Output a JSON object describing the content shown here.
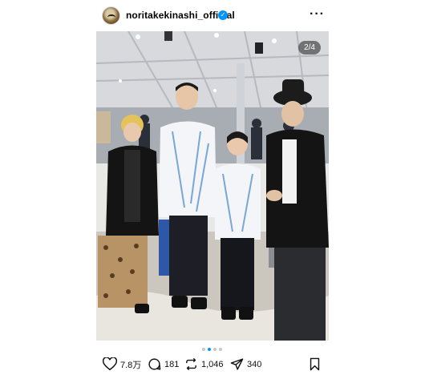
{
  "header": {
    "username": "noritakekinashi_official",
    "verified_icon": "verified-badge-icon",
    "more_icon": "more-options-icon"
  },
  "photo": {
    "counter": "2/4",
    "carousel": {
      "count": 4,
      "active_index": 1
    }
  },
  "actions": {
    "likes": "7.8万",
    "comments": "181",
    "reposts": "1,046",
    "shares": "340",
    "icons": [
      "heart-icon",
      "comment-icon",
      "repost-icon",
      "share-icon",
      "bookmark-icon"
    ]
  },
  "colors": {
    "accent": "#0095f6",
    "text": "#000000",
    "dot_inactive": "#c7c7c7"
  }
}
